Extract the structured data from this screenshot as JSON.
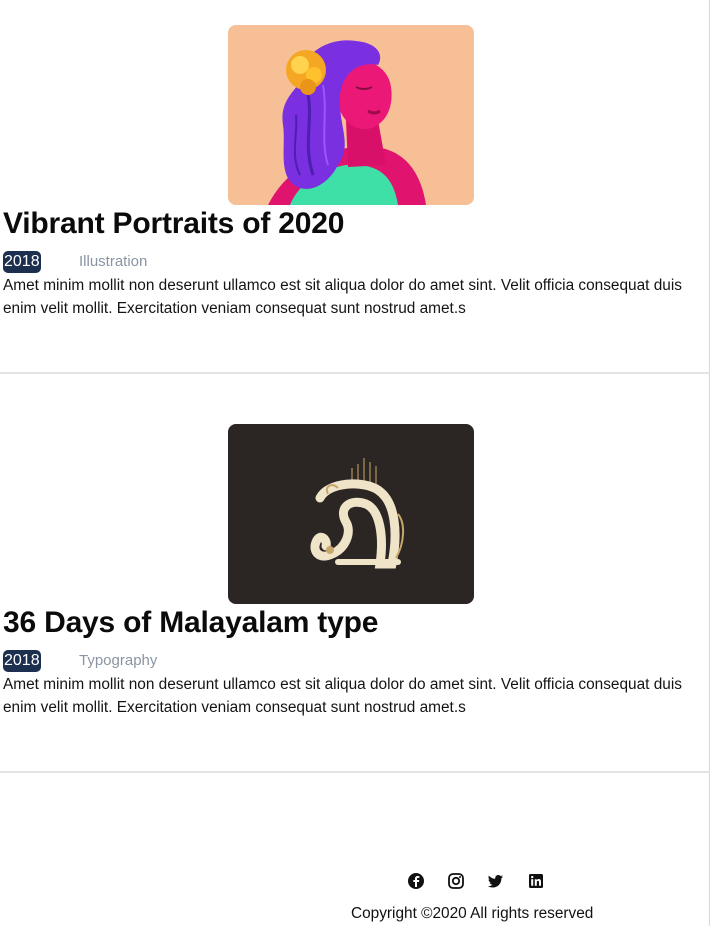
{
  "posts": [
    {
      "title": "Vibrant Portraits of 2020",
      "year": "2018",
      "category": "Illustration",
      "excerpt": "Amet minim mollit non deserunt ullamco est sit aliqua dolor do amet sint. Velit officia consequat duis enim velit mollit. Exercitation veniam consequat sunt nostrud amet.s",
      "thumbnail": "portrait-illustration"
    },
    {
      "title": "36 Days of Malayalam type",
      "year": "2018",
      "category": "Typography",
      "excerpt": "Amet minim mollit non deserunt ullamco est sit aliqua dolor do amet sint. Velit officia consequat duis enim velit mollit. Exercitation veniam consequat sunt nostrud amet.s",
      "thumbnail": "malayalam-letter-illustration"
    }
  ],
  "footer": {
    "social_icons": [
      "facebook-icon",
      "instagram-icon",
      "twitter-icon",
      "linkedin-icon"
    ],
    "copyright": "Copyright ©2020 All rights reserved"
  },
  "colors": {
    "year_badge_bg": "#1c2f4f",
    "category_text": "#8a95a3",
    "portrait_bg": "#f6bf96",
    "type_bg": "#2b2623"
  }
}
